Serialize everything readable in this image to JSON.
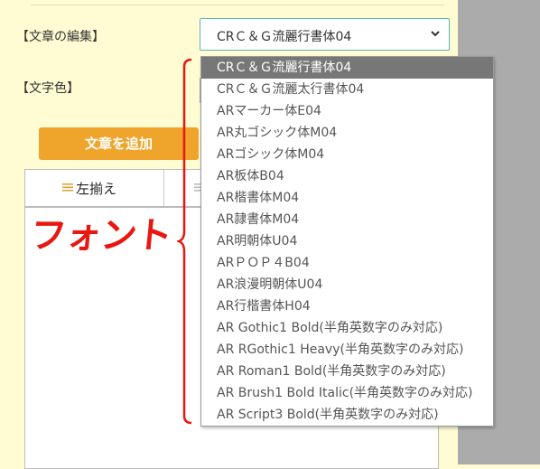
{
  "labels": {
    "edit": "【文章の編集】",
    "color": "【文字色】"
  },
  "font_select": {
    "value": "CRＣ＆Ｇ流麗行書体04",
    "icon": "chevron-down-icon"
  },
  "add_button": "文章を追加",
  "align": {
    "left_label": "左揃え",
    "icon": "align-left-icon"
  },
  "annotation": "フォント",
  "dropdown": {
    "options": [
      "CRＣ＆Ｇ流麗行書体04",
      "CRＣ＆Ｇ流麗太行書体04",
      "ARマーカー体E04",
      "AR丸ゴシック体M04",
      "ARゴシック体M04",
      "AR板体B04",
      "AR楷書体M04",
      "AR隷書体M04",
      "AR明朝体U04",
      "ARＰＯＰ４B04",
      "AR浪漫明朝体U04",
      "AR行楷書体H04",
      "AR Gothic1 Bold(半角英数字のみ対応)",
      "AR RGothic1 Heavy(半角英数字のみ対応)",
      "AR Roman1 Bold(半角英数字のみ対応)",
      "AR Brush1 Bold Italic(半角英数字のみ対応)",
      "AR Script3 Bold(半角英数字のみ対応)"
    ],
    "selected_index": 0
  },
  "colors": {
    "panel_bg": "#fffbd3",
    "button": "#efa52c",
    "annotation": "#e8170f",
    "selected_option": "#777777"
  }
}
